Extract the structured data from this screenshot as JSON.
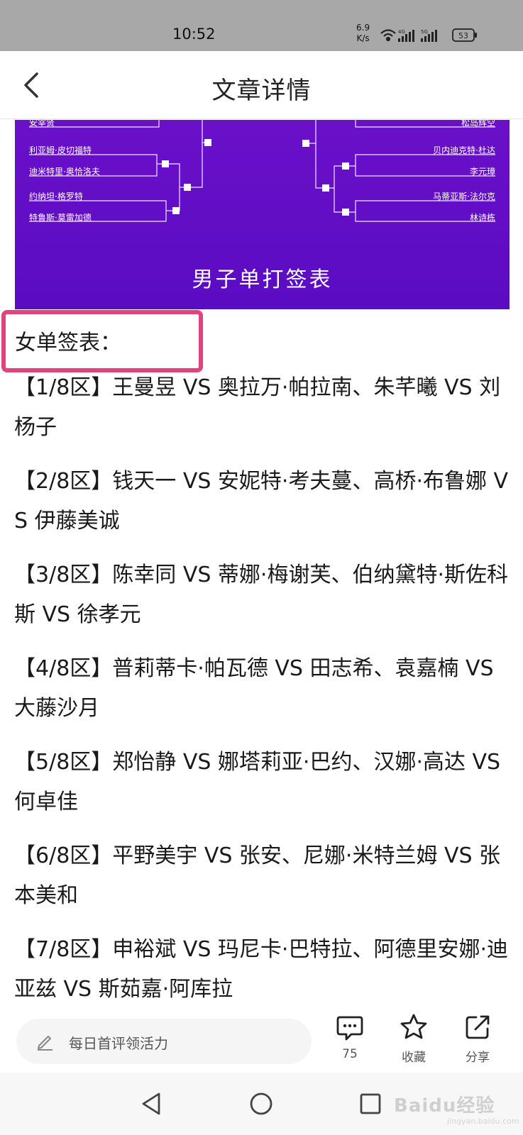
{
  "status_bar": {
    "time": "10:52",
    "speed_value": "6.9",
    "speed_unit": "K/s",
    "network_1": "4G",
    "network_2": "5G",
    "battery": "53"
  },
  "header": {
    "title": "文章详情",
    "back_icon": "chevron-left-icon"
  },
  "bracket_image": {
    "caption": "男子单打签表",
    "left_names": [
      "安宰贤",
      "利亚姆·皮切福特",
      "迪米特里·奥恰洛夫",
      "约纳坦·格罗特",
      "特鲁斯·莫雷加德"
    ],
    "right_names": [
      "松岛辉空",
      "贝内迪克特·杜达",
      "李元璋",
      "马蒂亚斯·法尔克",
      "林诗栋"
    ],
    "colors": {
      "background": "#6410c6",
      "lines": "#ffffff"
    }
  },
  "article": {
    "section_heading": "女单签表：",
    "highlight_color": "#e0437f",
    "entries": [
      "【1/8区】王曼昱 VS 奥拉万·帕拉南、朱芊曦 VS 刘杨子",
      "【2/8区】钱天一 VS 安妮特·考夫蔓、高桥·布鲁娜 VS 伊藤美诚",
      "【3/8区】陈幸同 VS 蒂娜·梅谢芙、伯纳黛特·斯佐科斯 VS 徐孝元",
      "【4/8区】普莉蒂卡·帕瓦德 VS 田志希、袁嘉楠 VS 大藤沙月",
      "【5/8区】郑怡静 VS 娜塔莉亚·巴约、汉娜·高达 VS 何卓佳",
      "【6/8区】平野美宇 VS 张安、尼娜·米特兰姆 VS 张本美和",
      "【7/8区】申裕斌 VS 玛尼卡·巴特拉、阿德里安娜·迪亚兹 VS 斯茹嘉·阿库拉"
    ]
  },
  "bottom_bar": {
    "comment_placeholder": "每日首评领活力",
    "comment_count": "75",
    "favorite_label": "收藏",
    "share_label": "分享"
  },
  "watermark": {
    "brand": "Baidu经验",
    "domain": "jingyan.baidu.com"
  }
}
